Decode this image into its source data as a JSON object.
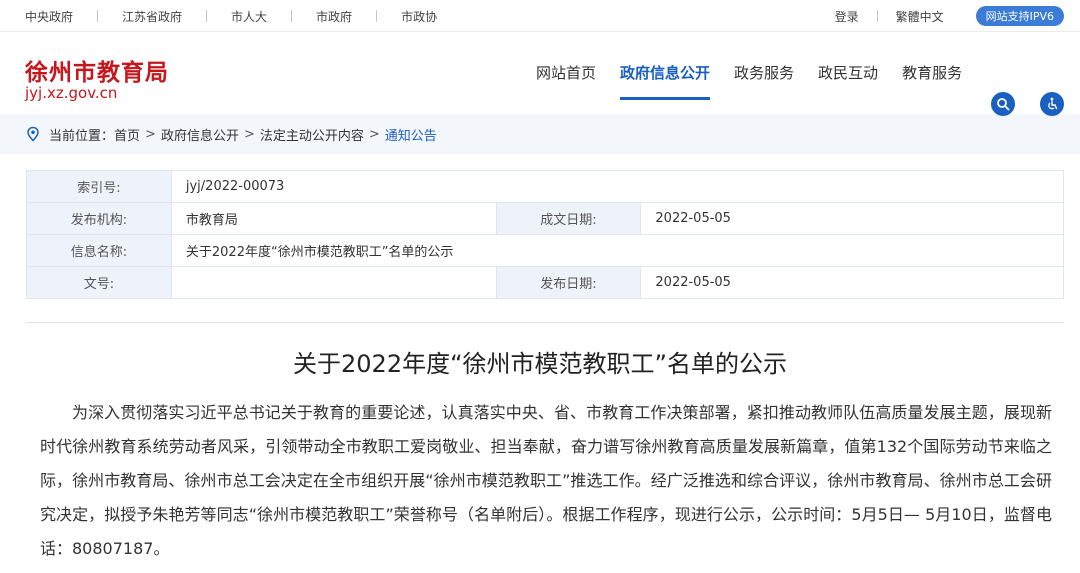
{
  "topbar": {
    "links": [
      "中央政府",
      "江苏省政府",
      "市人大",
      "市政府",
      "市政协"
    ],
    "login": "登录",
    "traditional": "繁體中文",
    "ipv6": "网站支持IPV6"
  },
  "header": {
    "title": "徐州市教育局",
    "url": "jyj.xz.gov.cn",
    "nav": [
      "网站首页",
      "政府信息公开",
      "政务服务",
      "政民互动",
      "教育服务"
    ],
    "active_nav_index": 1,
    "accent_color": "#1a5fc2",
    "brand_color": "#c8161d",
    "search_icon": "search-icon",
    "accessibility_icon": "accessibility-icon"
  },
  "breadcrumb": {
    "prefix": "当前位置：",
    "items": [
      "首页",
      "政府信息公开",
      "法定主动公开内容",
      "通知公告"
    ]
  },
  "meta": {
    "index_label": "索引号:",
    "index_value": "jyj/2022-00073",
    "org_label": "发布机构:",
    "org_value": "市教育局",
    "created_label": "成文日期:",
    "created_value": "2022-05-05",
    "name_label": "信息名称:",
    "name_value": "关于2022年度“徐州市模范教职工”名单的公示",
    "docno_label": "文号:",
    "docno_value": "",
    "published_label": "发布日期:",
    "published_value": "2022-05-05"
  },
  "article": {
    "title": "关于2022年度“徐州市模范教职工”名单的公示",
    "paragraph": "为深入贯彻落实习近平总书记关于教育的重要论述，认真落实中央、省、市教育工作决策部署，紧扣推动教师队伍高质量发展主题，展现新时代徐州教育系统劳动者风采，引领带动全市教职工爱岗敬业、担当奉献，奋力谱写徐州教育高质量发展新篇章，值第132个国际劳动节来临之际，徐州市教育局、徐州市总工会决定在全市组织开展“徐州市模范教职工”推选工作。经广泛推选和综合评议，徐州市教育局、徐州市总工会研究决定，拟授予朱艳芳等同志“徐州市模范教职工”荣誉称号（名单附后）。根据工作程序，现进行公示，公示时间：5月5日— 5月10日，监督电话：80807187。"
  }
}
